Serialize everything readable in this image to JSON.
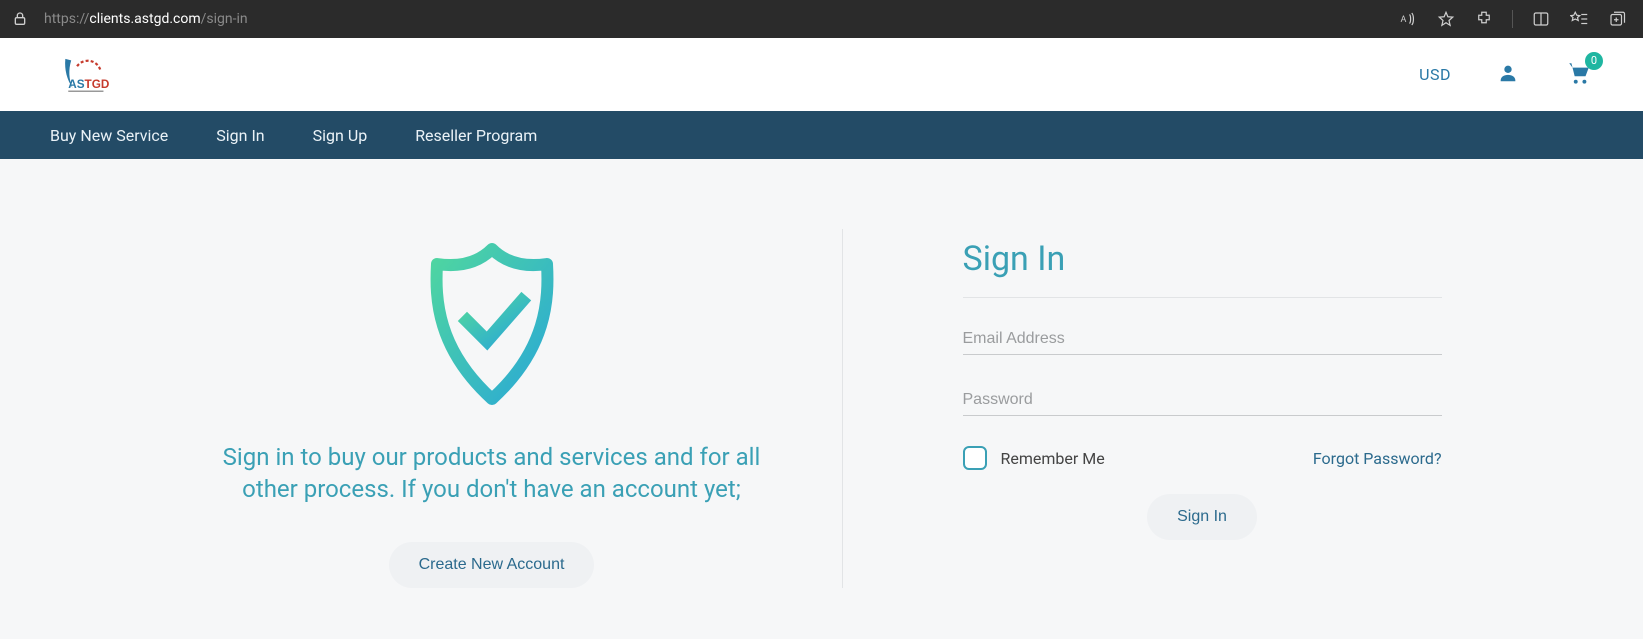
{
  "browser": {
    "url_scheme": "https://",
    "url_host": "clients.astgd.com",
    "url_path": "/sign-in"
  },
  "header": {
    "logo_text": "ASTGD",
    "currency": "USD",
    "cart_count": "0"
  },
  "nav": {
    "items": [
      "Buy New Service",
      "Sign In",
      "Sign Up",
      "Reseller Program"
    ]
  },
  "left": {
    "desc": "Sign in to buy our products and services and for all other process. If you don't have an account yet;",
    "create_btn": "Create New Account"
  },
  "form": {
    "title": "Sign In",
    "email_placeholder": "Email Address",
    "password_placeholder": "Password",
    "remember_label": "Remember Me",
    "forgot_label": "Forgot Password?",
    "submit_label": "Sign In"
  }
}
